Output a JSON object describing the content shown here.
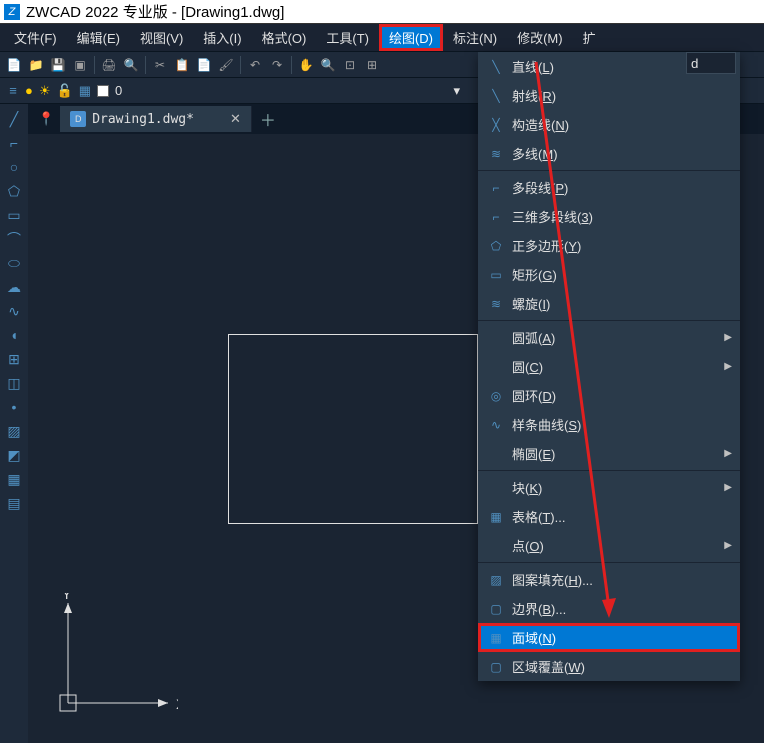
{
  "title": "ZWCAD 2022 专业版 - [Drawing1.dwg]",
  "menubar": {
    "items": [
      "文件(F)",
      "编辑(E)",
      "视图(V)",
      "插入(I)",
      "格式(O)",
      "工具(T)",
      "绘图(D)",
      "标注(N)",
      "修改(M)",
      "扩"
    ]
  },
  "layer": {
    "name": "0"
  },
  "tab": {
    "label": "Drawing1.dwg*"
  },
  "dropdown": {
    "cmd_input": "d",
    "items": [
      {
        "label": "直线(L)",
        "key": "L",
        "submenu": false
      },
      {
        "label": "射线(R)",
        "key": "R",
        "submenu": false
      },
      {
        "label": "构造线(N)",
        "key": "N",
        "submenu": false
      },
      {
        "label": "多线(M)",
        "key": "M",
        "submenu": false
      },
      {
        "sep": true
      },
      {
        "label": "多段线(P)",
        "key": "P",
        "submenu": false
      },
      {
        "label": "三维多段线(3)",
        "key": "3",
        "submenu": false
      },
      {
        "label": "正多边形(Y)",
        "key": "Y",
        "submenu": false
      },
      {
        "label": "矩形(G)",
        "key": "G",
        "submenu": false
      },
      {
        "label": "螺旋(I)",
        "key": "I",
        "submenu": false
      },
      {
        "sep": true
      },
      {
        "label": "圆弧(A)",
        "key": "A",
        "submenu": true
      },
      {
        "label": "圆(C)",
        "key": "C",
        "submenu": true
      },
      {
        "label": "圆环(D)",
        "key": "D",
        "submenu": false
      },
      {
        "label": "样条曲线(S)",
        "key": "S",
        "submenu": false
      },
      {
        "label": "椭圆(E)",
        "key": "E",
        "submenu": true
      },
      {
        "sep": true
      },
      {
        "label": "块(K)",
        "key": "K",
        "submenu": true
      },
      {
        "label": "表格(T)...",
        "key": "T",
        "submenu": false
      },
      {
        "label": "点(O)",
        "key": "O",
        "submenu": true
      },
      {
        "sep": true
      },
      {
        "label": "图案填充(H)...",
        "key": "H",
        "submenu": false
      },
      {
        "label": "边界(B)...",
        "key": "B",
        "submenu": false
      },
      {
        "label": "面域(N)",
        "key": "N",
        "submenu": false,
        "highlighted": true
      },
      {
        "label": "区域覆盖(W)",
        "key": "W",
        "submenu": false
      }
    ]
  },
  "ucs": {
    "x": "X",
    "y": "Y"
  }
}
